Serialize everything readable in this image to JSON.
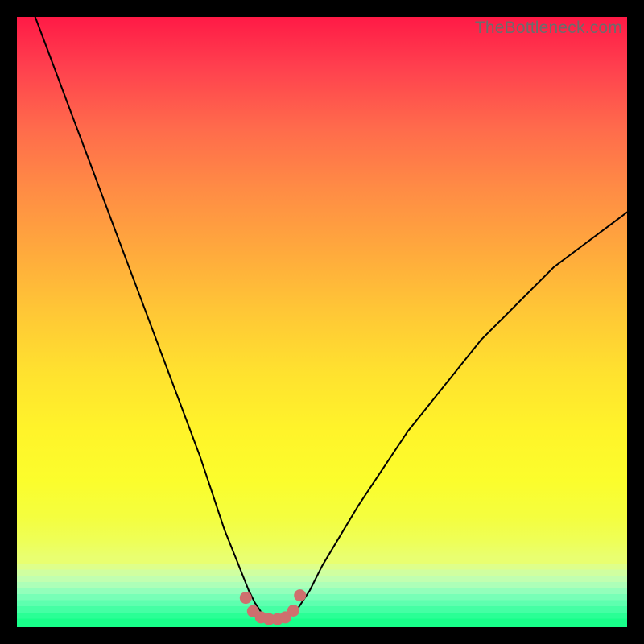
{
  "watermark": "TheBottleneck.com",
  "colors": {
    "curve_stroke": "#000000",
    "marker_fill": "#cf6f6e",
    "marker_stroke": "#cf6f6e"
  },
  "chart_data": {
    "type": "line",
    "title": "",
    "xlabel": "",
    "ylabel": "",
    "xlim": [
      0,
      100
    ],
    "ylim": [
      0,
      100
    ],
    "series": [
      {
        "name": "bottleneck-curve",
        "x": [
          0,
          3,
          6,
          9,
          12,
          15,
          18,
          21,
          24,
          27,
          30,
          32,
          34,
          36,
          38,
          39,
          40,
          41,
          42,
          43,
          44,
          46,
          48,
          50,
          53,
          56,
          60,
          64,
          68,
          72,
          76,
          80,
          84,
          88,
          92,
          96,
          100
        ],
        "y": [
          108,
          100,
          92,
          84,
          76,
          68,
          60,
          52,
          44,
          36,
          28,
          22,
          16,
          11,
          6,
          4,
          2.5,
          1.7,
          1.3,
          1.3,
          1.7,
          3,
          6,
          10,
          15,
          20,
          26,
          32,
          37,
          42,
          47,
          51,
          55,
          59,
          62,
          65,
          68
        ]
      }
    ],
    "markers": {
      "name": "flat-region-markers",
      "x": [
        37.5,
        38.7,
        40.0,
        41.3,
        42.7,
        44.0,
        45.3,
        46.4
      ],
      "y": [
        4.8,
        2.6,
        1.6,
        1.3,
        1.3,
        1.6,
        2.7,
        5.2
      ],
      "radius": 7
    },
    "annotations": []
  }
}
